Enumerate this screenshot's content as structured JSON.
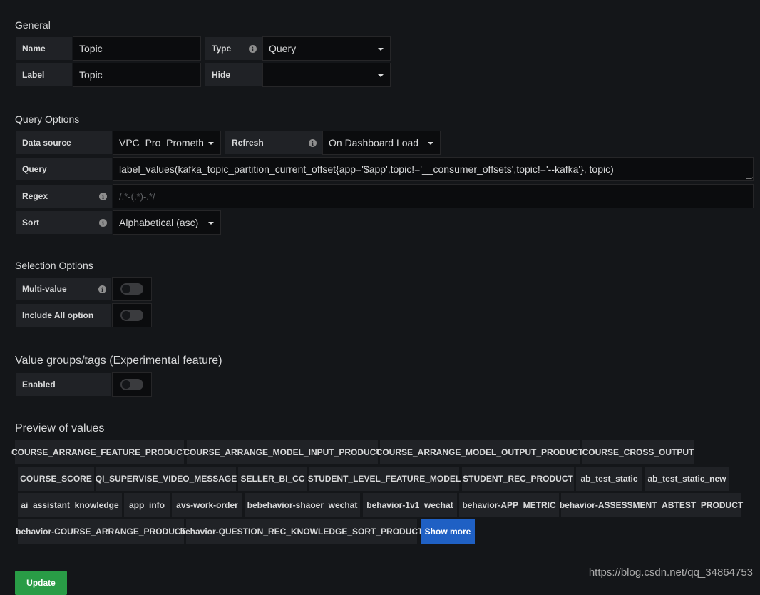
{
  "general": {
    "title": "General",
    "name_label": "Name",
    "name_value": "Topic",
    "type_label": "Type",
    "type_value": "Query",
    "label_label": "Label",
    "label_value": "Topic",
    "hide_label": "Hide",
    "hide_value": ""
  },
  "query_options": {
    "title": "Query Options",
    "datasource_label": "Data source",
    "datasource_value": "VPC_Pro_Prometh",
    "refresh_label": "Refresh",
    "refresh_value": "On Dashboard Load",
    "query_label": "Query",
    "query_value": "label_values(kafka_topic_partition_current_offset{app='$app',topic!='__consumer_offsets',topic!='--kafka'}, topic)",
    "regex_label": "Regex",
    "regex_placeholder": "/.*-(.*)-.*/",
    "sort_label": "Sort",
    "sort_value": "Alphabetical (asc)"
  },
  "selection_options": {
    "title": "Selection Options",
    "multi_label": "Multi-value",
    "include_all_label": "Include All option"
  },
  "value_groups": {
    "title": "Value groups/tags (Experimental feature)",
    "enabled_label": "Enabled"
  },
  "preview": {
    "title": "Preview of values",
    "tags": [
      "COURSE_ARRANGE_FEATURE_PRODUCT",
      "COURSE_ARRANGE_MODEL_INPUT_PRODUCT",
      "COURSE_ARRANGE_MODEL_OUTPUT_PRODUCT",
      "COURSE_CROSS_OUTPUT",
      "COURSE_SCORE",
      "QI_SUPERVISE_VIDEO_MESSAGE",
      "SELLER_BI_CC",
      "STUDENT_LEVEL_FEATURE_MODEL",
      "STUDENT_REC_PRODUCT",
      "ab_test_static",
      "ab_test_static_new",
      "ai_assistant_knowledge",
      "app_info",
      "avs-work-order",
      "bebehavior-shaoer_wechat",
      "behavior-1v1_wechat",
      "behavior-APP_METRIC",
      "behavior-ASSESSMENT_ABTEST_PRODUCT",
      "behavior-COURSE_ARRANGE_PRODUCT",
      "behavior-QUESTION_REC_KNOWLEDGE_SORT_PRODUCT"
    ],
    "show_more": "Show more"
  },
  "update_button": "Update",
  "watermark": "https://blog.csdn.net/qq_34864753"
}
